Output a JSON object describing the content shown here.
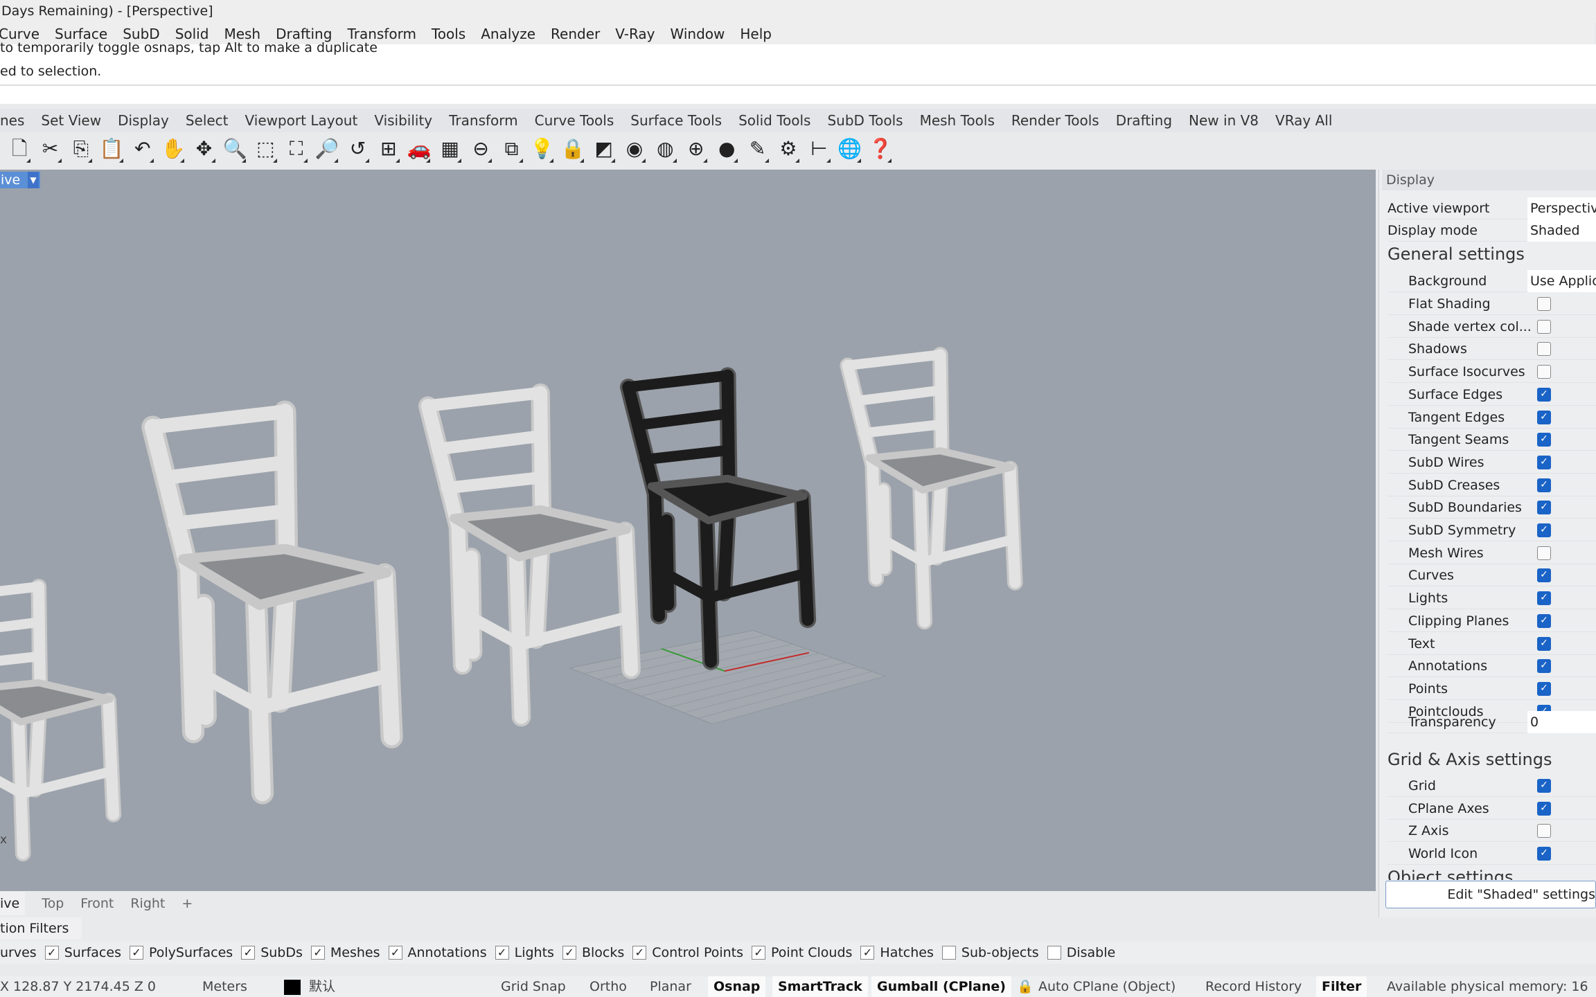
{
  "window": {
    "title": "Days Remaining) - [Perspective]"
  },
  "menu": [
    "Curve",
    "Surface",
    "SubD",
    "Solid",
    "Mesh",
    "Drafting",
    "Transform",
    "Tools",
    "Analyze",
    "Render",
    "V-Ray",
    "Window",
    "Help"
  ],
  "command": {
    "history": [
      "to temporarily toggle osnaps, tap Alt to make a duplicate",
      "ed to selection."
    ],
    "prompt": ""
  },
  "toolbar_tabs": [
    "nes",
    "Set View",
    "Display",
    "Select",
    "Viewport Layout",
    "Visibility",
    "Transform",
    "Curve Tools",
    "Surface Tools",
    "Solid Tools",
    "SubD Tools",
    "Mesh Tools",
    "Render Tools",
    "Drafting",
    "New in V8",
    "VRay All"
  ],
  "toolbar_icons": [
    {
      "name": "new-file-icon",
      "glyph": "🗋"
    },
    {
      "name": "cut-icon",
      "glyph": "✂"
    },
    {
      "name": "copy-icon",
      "glyph": "⎘"
    },
    {
      "name": "paste-icon",
      "glyph": "📋"
    },
    {
      "name": "undo-icon",
      "glyph": "↶"
    },
    {
      "name": "pan-hand-icon",
      "glyph": "✋"
    },
    {
      "name": "rotate-view-icon",
      "glyph": "✥"
    },
    {
      "name": "zoom-icon",
      "glyph": "🔍"
    },
    {
      "name": "zoom-window-icon",
      "glyph": "⬚"
    },
    {
      "name": "zoom-extents-icon",
      "glyph": "⛶"
    },
    {
      "name": "zoom-selected-icon",
      "glyph": "🔎"
    },
    {
      "name": "undo-view-icon",
      "glyph": "↺"
    },
    {
      "name": "four-viewports-icon",
      "glyph": "⊞"
    },
    {
      "name": "car-icon",
      "glyph": "🚗"
    },
    {
      "name": "cplane-grid-icon",
      "glyph": "▦"
    },
    {
      "name": "osnap-icon",
      "glyph": "⊖"
    },
    {
      "name": "select-objects-icon",
      "glyph": "⧉"
    },
    {
      "name": "light-bulb-icon",
      "glyph": "💡"
    },
    {
      "name": "lock-icon",
      "glyph": "🔒"
    },
    {
      "name": "layer-icon",
      "glyph": "◩"
    },
    {
      "name": "color-wheel-icon",
      "glyph": "◉"
    },
    {
      "name": "wireframe-sphere-icon",
      "glyph": "◍"
    },
    {
      "name": "shaded-sphere-icon",
      "glyph": "⊕"
    },
    {
      "name": "render-sphere-icon",
      "glyph": "●"
    },
    {
      "name": "pencil-icon",
      "glyph": "✎"
    },
    {
      "name": "gear-icon",
      "glyph": "⚙"
    },
    {
      "name": "dimension-icon",
      "glyph": "⊢"
    },
    {
      "name": "globe-icon",
      "glyph": "🌐"
    },
    {
      "name": "help-icon",
      "glyph": "❓"
    }
  ],
  "viewport": {
    "label": "ive",
    "axis_label": "x",
    "background": "#9ba2ab"
  },
  "viewport_tabs": [
    "ive",
    "Top",
    "Front",
    "Right",
    "+"
  ],
  "filters": {
    "tab": "tion Filters",
    "items": [
      {
        "label": "urves",
        "checked": null
      },
      {
        "label": "Surfaces",
        "checked": true
      },
      {
        "label": "PolySurfaces",
        "checked": true
      },
      {
        "label": "SubDs",
        "checked": true
      },
      {
        "label": "Meshes",
        "checked": true
      },
      {
        "label": "Annotations",
        "checked": true
      },
      {
        "label": "Lights",
        "checked": true
      },
      {
        "label": "Blocks",
        "checked": true
      },
      {
        "label": "Control Points",
        "checked": true
      },
      {
        "label": "Point Clouds",
        "checked": true
      },
      {
        "label": "Hatches",
        "checked": true
      },
      {
        "label": "Sub-objects",
        "checked": false
      },
      {
        "label": "Disable",
        "checked": false
      }
    ]
  },
  "status": {
    "coords": "X 128.87 Y 2174.45 Z 0",
    "units": "Meters",
    "layer": "默认",
    "grid_snap": "Grid Snap",
    "ortho": "Ortho",
    "planar": "Planar",
    "osnap": "Osnap",
    "smarttrack": "SmartTrack",
    "gumball": "Gumball (CPlane)",
    "auto_cplane": "Auto CPlane (Object)",
    "record_history": "Record History",
    "filter": "Filter",
    "memory": "Available physical memory: 16"
  },
  "panel": {
    "title": "Display",
    "active_viewport_label": "Active viewport",
    "active_viewport": "Perspective",
    "display_mode_label": "Display mode",
    "display_mode": "Shaded",
    "general_title": "General settings",
    "background_label": "Background",
    "background": "Use Application",
    "general": [
      {
        "label": "Flat Shading",
        "checked": false
      },
      {
        "label": "Shade vertex col...",
        "checked": false
      },
      {
        "label": "Shadows",
        "checked": false
      },
      {
        "label": "Surface Isocurves",
        "checked": false
      },
      {
        "label": "Surface Edges",
        "checked": true
      },
      {
        "label": "Tangent Edges",
        "checked": true
      },
      {
        "label": "Tangent Seams",
        "checked": true
      },
      {
        "label": "SubD Wires",
        "checked": true
      },
      {
        "label": "SubD Creases",
        "checked": true
      },
      {
        "label": "SubD Boundaries",
        "checked": true
      },
      {
        "label": "SubD Symmetry",
        "checked": true
      },
      {
        "label": "Mesh Wires",
        "checked": false
      },
      {
        "label": "Curves",
        "checked": true
      },
      {
        "label": "Lights",
        "checked": true
      },
      {
        "label": "Clipping Planes",
        "checked": true
      },
      {
        "label": "Text",
        "checked": true
      },
      {
        "label": "Annotations",
        "checked": true
      },
      {
        "label": "Points",
        "checked": true
      },
      {
        "label": "Pointclouds",
        "checked": true
      }
    ],
    "transparency_label": "Transparency",
    "transparency": "0",
    "grid_title": "Grid & Axis settings",
    "grid": [
      {
        "label": "Grid",
        "checked": true
      },
      {
        "label": "CPlane Axes",
        "checked": true
      },
      {
        "label": "Z Axis",
        "checked": false
      },
      {
        "label": "World Icon",
        "checked": true
      }
    ],
    "object_title": "Object settings",
    "edit_button": "Edit \"Shaded\" settings"
  },
  "colors": {
    "accent": "#1a63c7",
    "viewport_bg": "#9ba2ab",
    "chair": "#e2e2e2",
    "chair_selected": "#1c1c1c"
  }
}
